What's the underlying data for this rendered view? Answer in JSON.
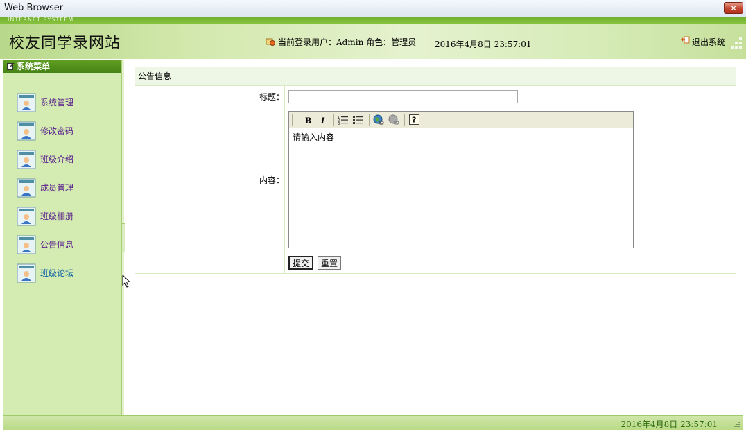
{
  "window": {
    "title": "Web Browser",
    "close_label": "✕"
  },
  "header": {
    "tagline": "INTERNET SYSTEEM",
    "site_name": "校友同学录网站",
    "user_info": "当前登录用户：Admin 角色：管理员",
    "datetime": "2016年4月8日  23:57:01",
    "logout_label": "退出系统"
  },
  "sidebar": {
    "title": "系统菜单",
    "items": [
      {
        "label": "系统管理"
      },
      {
        "label": "修改密码"
      },
      {
        "label": "班级介绍"
      },
      {
        "label": "成员管理"
      },
      {
        "label": "班级相册"
      },
      {
        "label": "公告信息"
      },
      {
        "label": "班级论坛"
      }
    ]
  },
  "form": {
    "section_title": "公告信息",
    "title_label": "标题：",
    "title_value": "",
    "content_label": "内容：",
    "content_placeholder": "请输入内容",
    "toolbar": [
      "bold",
      "italic",
      "ordered-list",
      "unordered-list",
      "insert-link",
      "remove-link",
      "help"
    ],
    "submit_label": "提交",
    "reset_label": "重置"
  },
  "footer": {
    "datetime": "2016年4月8日  23:57:01"
  }
}
